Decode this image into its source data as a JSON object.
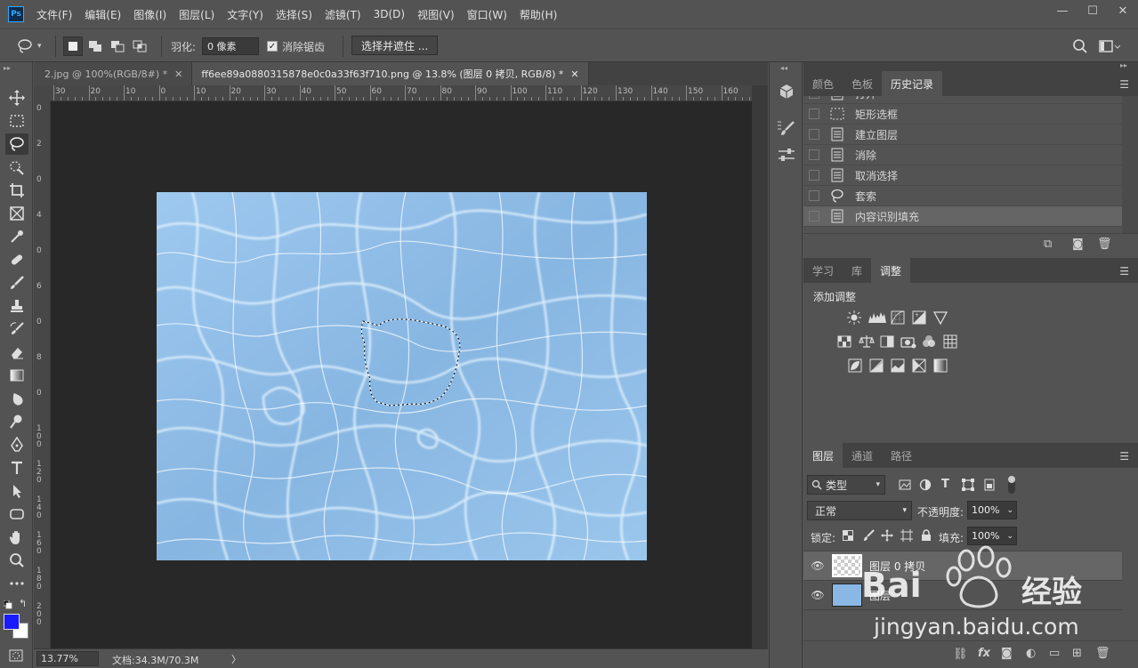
{
  "app": {
    "logo": "Ps"
  },
  "menubar": {
    "items": [
      "文件(F)",
      "编辑(E)",
      "图像(I)",
      "图层(L)",
      "文字(Y)",
      "选择(S)",
      "滤镜(T)",
      "3D(D)",
      "视图(V)",
      "窗口(W)",
      "帮助(H)"
    ]
  },
  "window_controls": {
    "minimize": "—",
    "restore": "☐",
    "close": "✕"
  },
  "options": {
    "feather_label": "羽化:",
    "feather_value": "0 像素",
    "antialias_label": "消除锯齿",
    "select_mask_label": "选择并遮住 ..."
  },
  "tabs": [
    {
      "label": "2.jpg @ 100%(RGB/8#) *"
    },
    {
      "label": "ff6ee89a0880315878e0c0a33f63f710.png @ 13.8% (图层 0 拷贝, RGB/8) *"
    }
  ],
  "ruler": {
    "top_labels": [
      "30",
      "20",
      "10",
      "0",
      "10",
      "20",
      "30",
      "40",
      "50",
      "60",
      "70",
      "80",
      "90",
      "100",
      "110",
      "120",
      "130",
      "140",
      "150",
      "160"
    ],
    "left_labels": [
      "0",
      "2",
      "0",
      "4",
      "0",
      "6",
      "0",
      "8",
      "0",
      "1 0 0",
      "1 2 0",
      "1 4 0",
      "1 6 0",
      "1 8 0",
      "2 0 0"
    ]
  },
  "status": {
    "zoom": "13.77%",
    "doc_label": "文档:34.3M/70.3M",
    "arrow": "〉"
  },
  "history_panel": {
    "tabs": [
      "颜色",
      "色板",
      "历史记录"
    ],
    "active_tab": 2,
    "items": [
      {
        "label": "打开",
        "icon": "document-icon"
      },
      {
        "label": "矩形选框",
        "icon": "rect-marquee-icon"
      },
      {
        "label": "建立图层",
        "icon": "document-icon"
      },
      {
        "label": "消除",
        "icon": "document-icon"
      },
      {
        "label": "取消选择",
        "icon": "document-icon"
      },
      {
        "label": "套索",
        "icon": "lasso-icon"
      },
      {
        "label": "内容识别填充",
        "icon": "document-icon",
        "selected": true
      }
    ]
  },
  "adjust_panel": {
    "tabs": [
      "学习",
      "库",
      "调整"
    ],
    "active_tab": 2,
    "heading": "添加调整"
  },
  "layers_panel": {
    "tabs": [
      "图层",
      "通道",
      "路径"
    ],
    "active_tab": 0,
    "filter_label": "类型",
    "blend_mode": "正常",
    "opacity_label": "不透明度:",
    "opacity_value": "100%",
    "lock_label": "锁定:",
    "fill_label": "填充:",
    "fill_value": "100%",
    "layers": [
      {
        "name": "图层 0 拷贝",
        "selected": true,
        "thumb": "transparent"
      },
      {
        "name": "图层",
        "selected": false,
        "thumb": "water"
      }
    ]
  },
  "colors": {
    "foreground": "#1a1aff",
    "background": "#ffffff",
    "water": "#8ab8e4"
  },
  "watermark": {
    "brand": "Bai",
    "brand_suffix": "经验",
    "url": "jingyan.baidu.com"
  }
}
